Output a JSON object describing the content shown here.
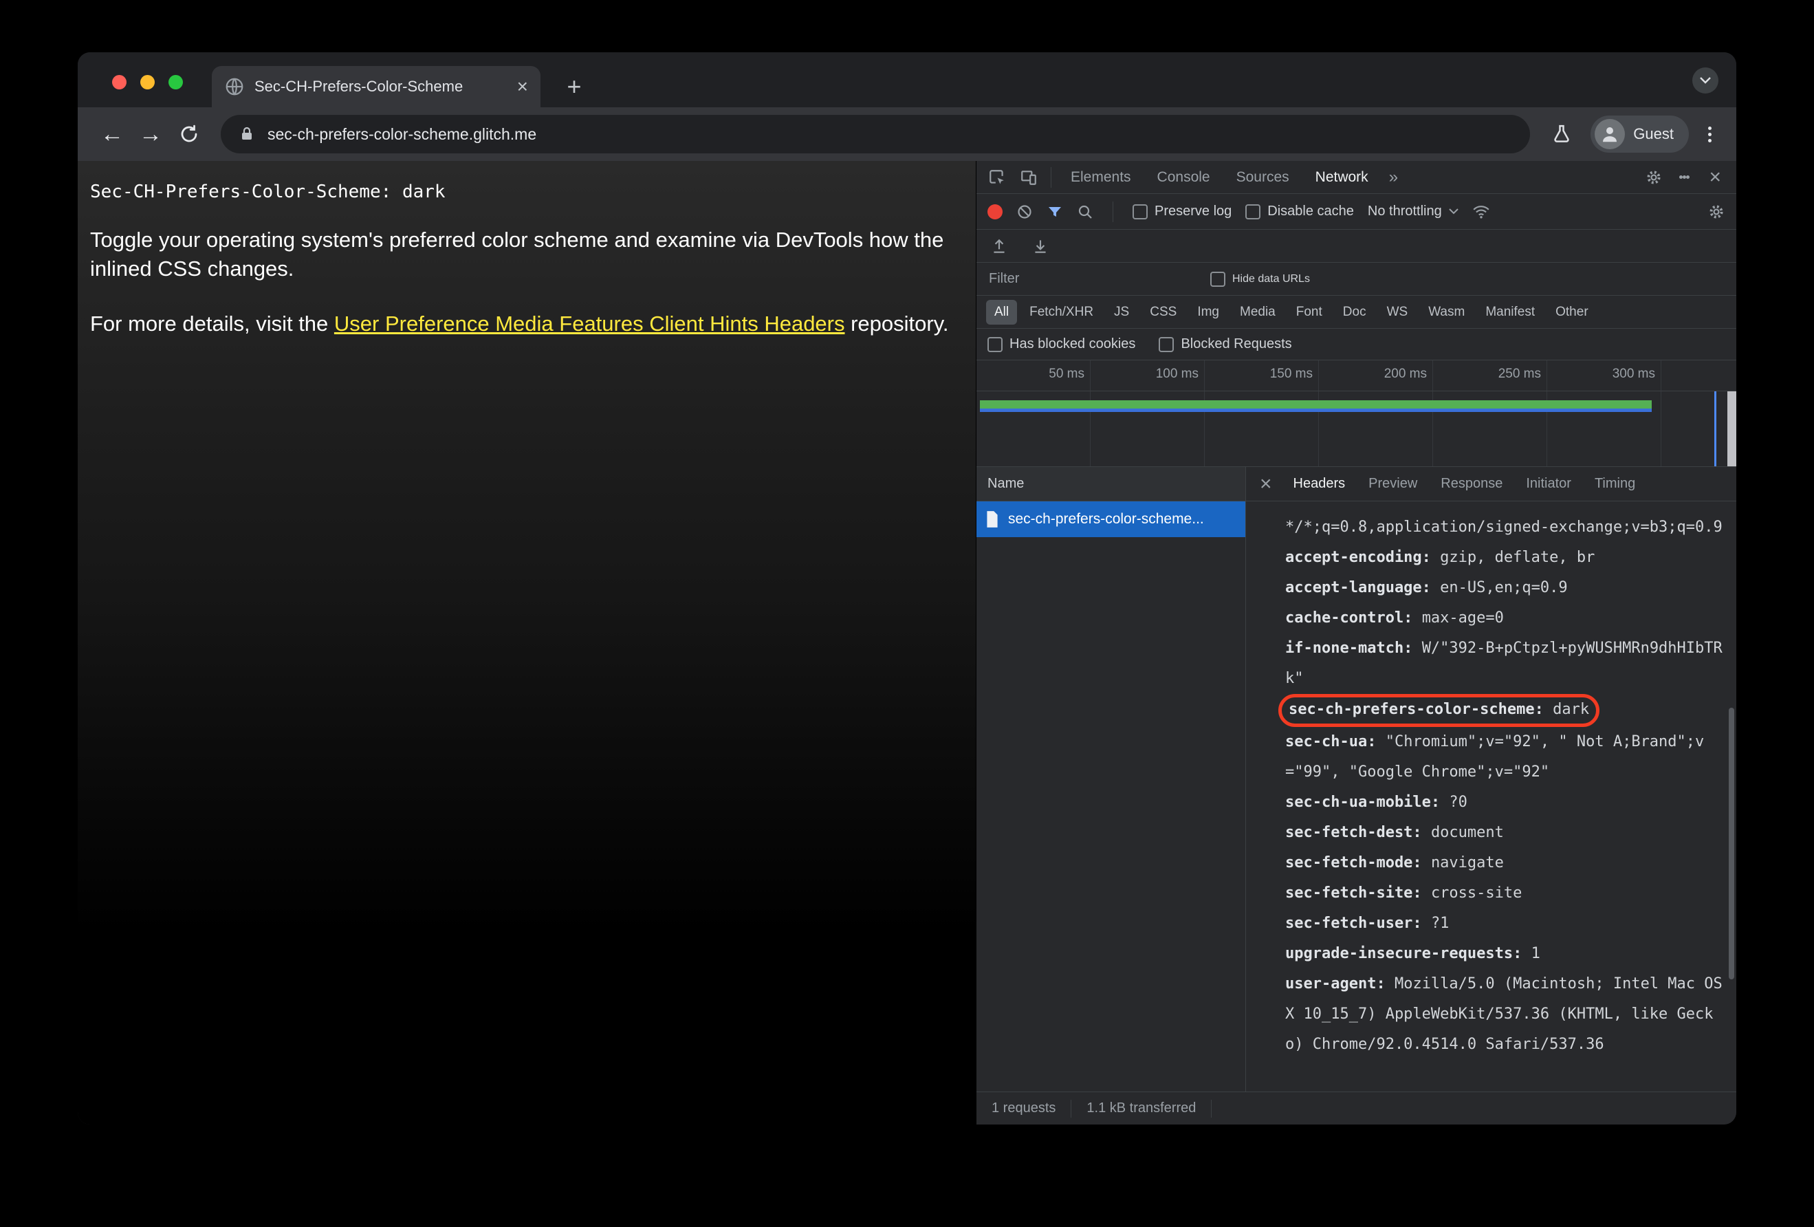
{
  "window": {
    "tab_title": "Sec-CH-Prefers-Color-Scheme",
    "url": "sec-ch-prefers-color-scheme.glitch.me",
    "profile_label": "Guest"
  },
  "page": {
    "status_line": "Sec-CH-Prefers-Color-Scheme: dark",
    "intro": "Toggle your operating system's preferred color scheme and examine via DevTools how the inlined CSS changes.",
    "details_prefix": "For more details, visit the ",
    "details_link": "User Preference Media Features Client Hints Headers",
    "details_suffix": " repository."
  },
  "devtools": {
    "tabs": [
      {
        "label": "Elements"
      },
      {
        "label": "Console"
      },
      {
        "label": "Sources"
      },
      {
        "label": "Network"
      }
    ],
    "overflow_chevron": "»",
    "controls": {
      "preserve_log": "Preserve log",
      "disable_cache": "Disable cache",
      "throttling": "No throttling"
    },
    "filter": {
      "placeholder": "Filter",
      "hide_data_urls": "Hide data URLs"
    },
    "pills": [
      {
        "label": "All"
      },
      {
        "label": "Fetch/XHR"
      },
      {
        "label": "JS"
      },
      {
        "label": "CSS"
      },
      {
        "label": "Img"
      },
      {
        "label": "Media"
      },
      {
        "label": "Font"
      },
      {
        "label": "Doc"
      },
      {
        "label": "WS"
      },
      {
        "label": "Wasm"
      },
      {
        "label": "Manifest"
      },
      {
        "label": "Other"
      }
    ],
    "blocked": {
      "cookies": "Has blocked cookies",
      "requests": "Blocked Requests"
    },
    "timeline_ticks": [
      {
        "label": "50 ms"
      },
      {
        "label": "100 ms"
      },
      {
        "label": "150 ms"
      },
      {
        "label": "200 ms"
      },
      {
        "label": "250 ms"
      },
      {
        "label": "300 ms"
      }
    ],
    "table": {
      "name_header": "Name",
      "request_name": "sec-ch-prefers-color-scheme..."
    },
    "detail_tabs": [
      {
        "label": "Headers"
      },
      {
        "label": "Preview"
      },
      {
        "label": "Response"
      },
      {
        "label": "Initiator"
      },
      {
        "label": "Timing"
      }
    ],
    "headers": [
      {
        "name": "",
        "value": "*/*;q=0.8,application/signed-exchange;v=b3;q=0.9"
      },
      {
        "name": "accept-encoding:",
        "value": "gzip, deflate, br"
      },
      {
        "name": "accept-language:",
        "value": "en-US,en;q=0.9"
      },
      {
        "name": "cache-control:",
        "value": "max-age=0"
      },
      {
        "name": "if-none-match:",
        "value": "W/\"392-B+pCtpzl+pyWUSHMRn9dhHIbTRk\""
      },
      {
        "name": "sec-ch-prefers-color-scheme:",
        "value": "dark"
      },
      {
        "name": "sec-ch-ua:",
        "value": "\"Chromium\";v=\"92\", \" Not A;Brand\";v=\"99\", \"Google Chrome\";v=\"92\""
      },
      {
        "name": "sec-ch-ua-mobile:",
        "value": "?0"
      },
      {
        "name": "sec-fetch-dest:",
        "value": "document"
      },
      {
        "name": "sec-fetch-mode:",
        "value": "navigate"
      },
      {
        "name": "sec-fetch-site:",
        "value": "cross-site"
      },
      {
        "name": "sec-fetch-user:",
        "value": "?1"
      },
      {
        "name": "upgrade-insecure-requests:",
        "value": "1"
      },
      {
        "name": "user-agent:",
        "value": "Mozilla/5.0 (Macintosh; Intel Mac OS X 10_15_7) AppleWebKit/537.36 (KHTML, like Gecko) Chrome/92.0.4514.0 Safari/537.36"
      }
    ],
    "status": {
      "requests": "1 requests",
      "transferred": "1.1 kB transferred"
    }
  },
  "colors": {
    "traffic_red": "#ff5f57",
    "traffic_yellow": "#febc2e",
    "traffic_green": "#28c840",
    "link_yellow": "#ffe93e",
    "highlight_red": "#f23b22",
    "selection_blue": "#1a66c2",
    "timeline_green": "#55b054",
    "timeline_blue": "#3a6fd8",
    "record_red": "#ec4136",
    "filter_blue": "#8ab4f8"
  }
}
